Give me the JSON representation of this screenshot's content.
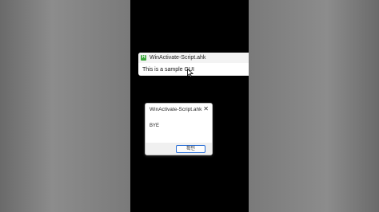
{
  "gui_window": {
    "title": "WinActivate-Script.ahk",
    "icon": "H",
    "text": "This is a sample GUI"
  },
  "msgbox": {
    "title": "WinActivate-Script.ahk",
    "close_glyph": "✕",
    "message": "BYE",
    "ok_label": "확인"
  },
  "colors": {
    "icon_green": "#3aa63a",
    "button_border": "#2a6fd6",
    "background": "#000000"
  }
}
